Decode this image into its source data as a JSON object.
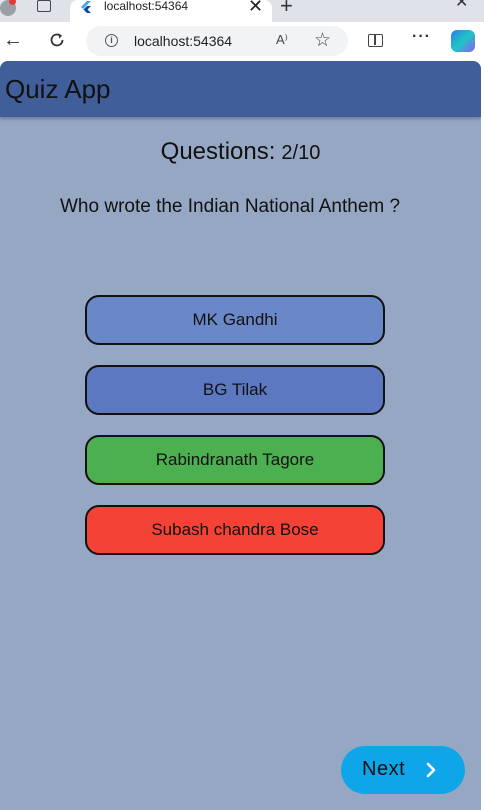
{
  "browser": {
    "tab_title": "localhost:54364",
    "tab_close": "✕",
    "new_tab": "+",
    "win_min": "—",
    "win_close": "✕",
    "back": "←",
    "url": "localhost:54364",
    "read_aloud": "A⁾",
    "favorite": "☆",
    "more": "···"
  },
  "app": {
    "title": "Quiz App",
    "counter_label": "Questions:",
    "counter_value": "2/10",
    "question": "Who wrote the Indian National Anthem ?",
    "options": [
      "MK Gandhi",
      "BG Tilak",
      "Rabindranath Tagore",
      "Subash chandra Bose"
    ],
    "option_states": [
      "default",
      "default",
      "correct",
      "wrong"
    ],
    "next_label": "Next"
  },
  "colors": {
    "app_background": "#96a7c4",
    "appbar": "#3f5e9a",
    "option_default": "#6a87c7",
    "option_correct": "#4caf50",
    "option_wrong": "#f44336",
    "next_button": "#0ea5e9"
  },
  "icons": {
    "back": "back-arrow-icon",
    "refresh": "refresh-icon",
    "info": "info-icon",
    "read_aloud": "read-aloud-icon",
    "favorite": "star-icon",
    "split": "split-screen-icon",
    "more": "more-icon",
    "copilot": "copilot-icon",
    "next": "chevron-right-icon"
  }
}
